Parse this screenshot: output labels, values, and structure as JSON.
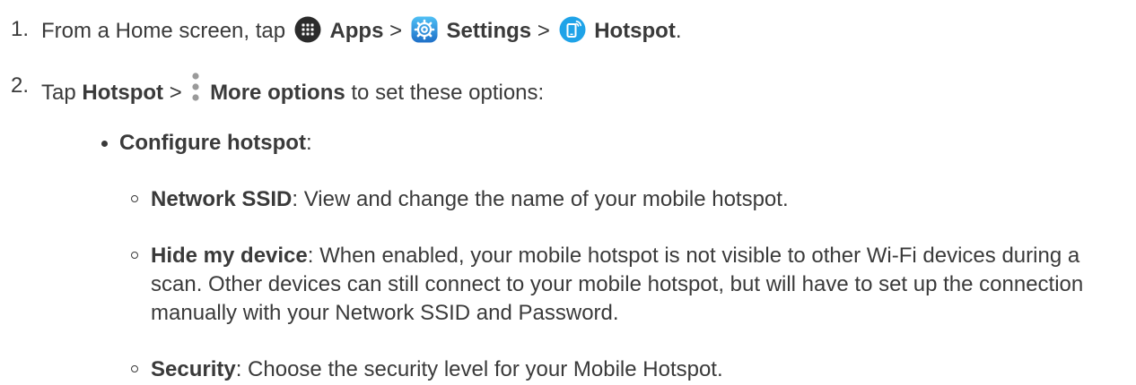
{
  "step1": {
    "number": "1.",
    "prefix": "From a Home screen, tap ",
    "apps_label": "Apps",
    "sep1": " > ",
    "settings_label": "Settings",
    "sep2": " > ",
    "hotspot_label": "Hotspot",
    "suffix": "."
  },
  "step2": {
    "number": "2.",
    "prefix": "Tap ",
    "hotspot_label": "Hotspot",
    "sep": " > ",
    "more_options_label": "More options",
    "suffix": " to set these options:"
  },
  "configure": {
    "label": "Configure hotspot",
    "suffix": ":"
  },
  "options": [
    {
      "term": "Network SSID",
      "desc": ": View and change the name of your mobile hotspot."
    },
    {
      "term": "Hide my device",
      "desc": ": When enabled, your mobile hotspot is not visible to other Wi-Fi devices during a scan. Other devices can still connect to your mobile hotspot, but will have to set up the connection manually with your Network SSID and Password."
    },
    {
      "term": "Security",
      "desc": ": Choose the security level for your Mobile Hotspot."
    }
  ],
  "colors": {
    "text": "#3a3a3a",
    "apps_icon_bg": "#2b2b2b",
    "settings_icon_bg": "#2a8fd8",
    "hotspot_icon_bg": "#1fa3e8"
  },
  "icons": {
    "apps": "apps-grid-icon",
    "settings": "settings-gear-icon",
    "hotspot": "hotspot-phone-icon",
    "more_options": "more-options-vertical-dots-icon"
  }
}
